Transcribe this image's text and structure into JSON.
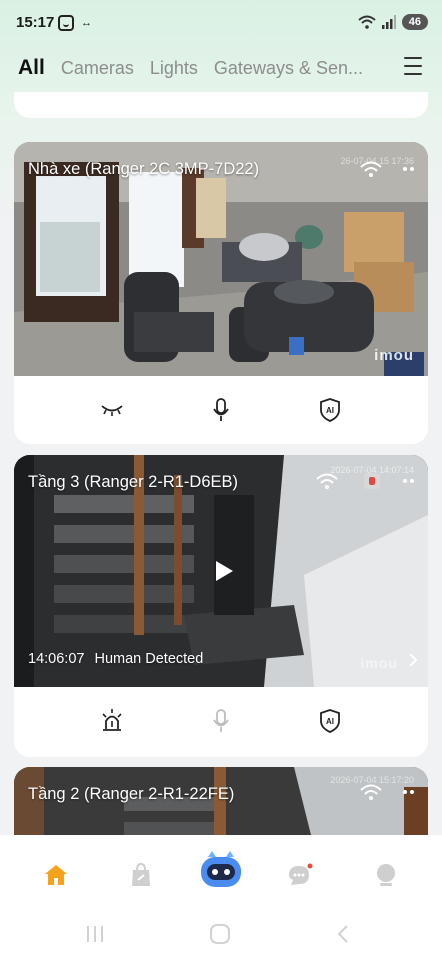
{
  "status_bar": {
    "time": "15:17",
    "battery": "46",
    "icons": [
      "app-face-icon",
      "link-icon",
      "wifi-icon",
      "signal-icon"
    ]
  },
  "tabs": [
    {
      "label": "All",
      "active": true
    },
    {
      "label": "Cameras",
      "active": false
    },
    {
      "label": "Lights",
      "active": false
    },
    {
      "label": "Gateways & Sen...",
      "active": false
    }
  ],
  "cameras": [
    {
      "title": "Nhà xe (Ranger 2C 3MP-7D22)",
      "timestamp": "26-07-04 15 17:36",
      "watermark": "imou",
      "actions": [
        "eye-closed-icon",
        "microphone-icon",
        "ai-shield-icon"
      ]
    },
    {
      "title": "Tầng 3 (Ranger 2-R1-D6EB)",
      "timestamp": "2026-07-04 14:07:14",
      "event_time": "14:06:07",
      "event_label": "Human Detected",
      "watermark": "imou",
      "actions": [
        "alarm-siren-icon",
        "microphone-icon",
        "ai-shield-icon"
      ]
    },
    {
      "title": "Tầng 2 (Ranger 2-R1-22FE)",
      "timestamp": "2026-07-04 15:17:20"
    }
  ],
  "bottom_nav": [
    "home-icon",
    "shop-bag-icon",
    "robot-assistant-icon",
    "chat-icon",
    "profile-icon"
  ],
  "colors": {
    "accent": "#f5a21c",
    "robot": "#4a8cf0",
    "header_gradient": "#d9f1e3",
    "background": "#f1f2f4"
  }
}
